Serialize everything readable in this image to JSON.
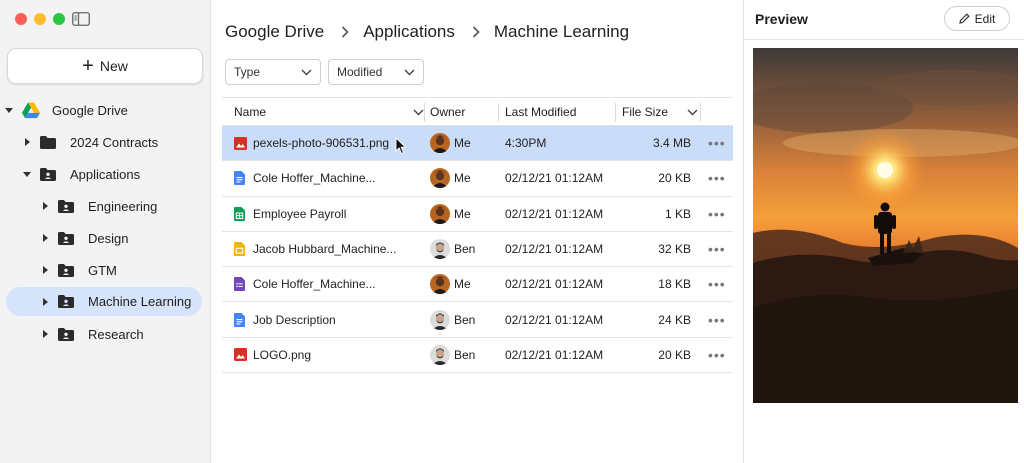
{
  "window": {
    "controls": [
      "close",
      "minimize",
      "zoom"
    ],
    "sidebar_toggle_icon": "sidebar-icon"
  },
  "sidebar": {
    "new_button": {
      "icon": "plus-icon",
      "label": "New"
    },
    "tree": [
      {
        "label": "Google Drive",
        "icon": "google-drive-icon",
        "expanded": true,
        "level": 0
      },
      {
        "label": "2024 Contracts",
        "icon": "folder-icon",
        "expanded": false,
        "level": 1
      },
      {
        "label": "Applications",
        "icon": "shared-folder-icon",
        "expanded": true,
        "level": 1
      },
      {
        "label": "Engineering",
        "icon": "shared-folder-icon",
        "expanded": false,
        "level": 2
      },
      {
        "label": "Design",
        "icon": "shared-folder-icon",
        "expanded": false,
        "level": 2
      },
      {
        "label": "GTM",
        "icon": "shared-folder-icon",
        "expanded": false,
        "level": 2
      },
      {
        "label": "Machine Learning",
        "icon": "shared-folder-icon",
        "expanded": false,
        "level": 2,
        "active": true
      },
      {
        "label": "Research",
        "icon": "shared-folder-icon",
        "expanded": false,
        "level": 2
      }
    ]
  },
  "breadcrumb": [
    "Google Drive",
    "Applications",
    "Machine Learning"
  ],
  "filters": [
    {
      "label": "Type",
      "icon": "chevron-down-icon"
    },
    {
      "label": "Modified",
      "icon": "chevron-down-icon"
    }
  ],
  "table": {
    "columns": {
      "name": "Name",
      "owner": "Owner",
      "modified": "Last Modified",
      "size": "File Size"
    },
    "rows": [
      {
        "name": "pexels-photo-906531.png",
        "type": "image",
        "owner": "Me",
        "modified": "4:30PM",
        "size": "3.4 MB",
        "selected": true
      },
      {
        "name": "Cole Hoffer_Machine...",
        "type": "doc",
        "owner": "Me",
        "modified": "02/12/21 01:12AM",
        "size": "20 KB"
      },
      {
        "name": "Employee Payroll",
        "type": "sheet",
        "owner": "Me",
        "modified": "02/12/21 01:12AM",
        "size": "1 KB"
      },
      {
        "name": "Jacob Hubbard_Machine...",
        "type": "slides",
        "owner": "Ben",
        "modified": "02/12/21 01:12AM",
        "size": "32 KB"
      },
      {
        "name": "Cole Hoffer_Machine...",
        "type": "form",
        "owner": "Me",
        "modified": "02/12/21 01:12AM",
        "size": "18 KB"
      },
      {
        "name": "Job Description",
        "type": "doc",
        "owner": "Ben",
        "modified": "02/12/21 01:12AM",
        "size": "24 KB"
      },
      {
        "name": "LOGO.png",
        "type": "image",
        "owner": "Ben",
        "modified": "02/12/21 01:12AM",
        "size": "20 KB"
      }
    ],
    "more_label": "•••"
  },
  "preview": {
    "title": "Preview",
    "edit_label": "Edit",
    "edit_icon": "pencil-icon"
  },
  "colors": {
    "selection": "#c9dcf8",
    "active_sidebar": "#d6e4fb",
    "doc": "#4285f4",
    "sheet": "#0f9d58",
    "slides": "#f4b400",
    "form": "#7248b9",
    "image": "#d93025"
  }
}
